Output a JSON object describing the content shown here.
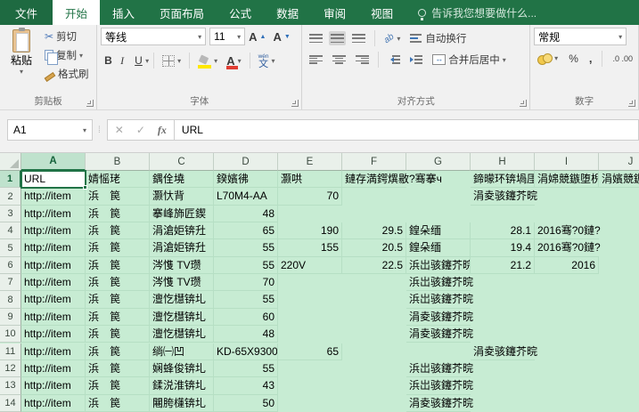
{
  "app": {
    "accent_color": "#217346",
    "fill_color": "#c7ecd3"
  },
  "tabbar": {
    "tabs": [
      "文件",
      "开始",
      "插入",
      "页面布局",
      "公式",
      "数据",
      "审阅",
      "视图"
    ],
    "active": "开始",
    "tell_me": "告诉我您想要做什么..."
  },
  "ribbon": {
    "clipboard": {
      "label": "剪贴板",
      "paste": "粘贴",
      "cut": "剪切",
      "copy": "复制",
      "format_painter": "格式刷"
    },
    "font": {
      "label": "字体",
      "family": "等线",
      "size": "11",
      "phonetic": "文",
      "phonetic_hint": "wén"
    },
    "alignment": {
      "label": "对齐方式",
      "wrap": "自动换行",
      "merge": "合并后居中"
    },
    "number": {
      "label": "数字",
      "format": "常规",
      "decimal_icons": ".0 .00",
      "percent": "%",
      "comma": ","
    }
  },
  "formula_bar": {
    "name_box": "A1",
    "cancel": "✕",
    "enter": "✓",
    "fx": "fx",
    "formula": "URL"
  },
  "sheet": {
    "columns": [
      "A",
      "B",
      "C",
      "D",
      "E",
      "F",
      "G",
      "H",
      "I",
      "J"
    ],
    "rows": 14,
    "selected": "A1",
    "cells": [
      {
        "ref": "A1",
        "v": "URL"
      },
      {
        "ref": "B1",
        "v": "婧愮珯"
      },
      {
        "ref": "C1",
        "v": "鍝佺墝"
      },
      {
        "ref": "D1",
        "v": "鍨嬪彿"
      },
      {
        "ref": "E1",
        "v": "灏哄"
      },
      {
        "ref": "F1",
        "v": "鏈存満鍔熼敭?骞搴ч",
        "of": true
      },
      {
        "ref": "H1",
        "v": "鍗曚环锛堝厓锛?"
      },
      {
        "ref": "I1",
        "v": "涓婂競鏃堕棿"
      },
      {
        "ref": "J1",
        "v": "涓嬪競鏃堕棿"
      },
      {
        "ref": "A2",
        "v": "http://item"
      },
      {
        "ref": "B2",
        "v": "浜　笢"
      },
      {
        "ref": "C2",
        "v": "灏忕背"
      },
      {
        "ref": "D2",
        "v": "L70M4-AA"
      },
      {
        "ref": "E2",
        "v": "70",
        "a": "r"
      },
      {
        "ref": "H2",
        "v": "涓夌骇鑳芥晥",
        "of": true
      },
      {
        "ref": "A3",
        "v": "http://item"
      },
      {
        "ref": "B3",
        "v": "浜　笢"
      },
      {
        "ref": "C3",
        "v": "搴峰斾匠鍥"
      },
      {
        "ref": "D3",
        "v": "48",
        "a": "r"
      },
      {
        "ref": "A4",
        "v": "http://item"
      },
      {
        "ref": "B4",
        "v": "浜　笢"
      },
      {
        "ref": "C4",
        "v": "涓滄姖锛圱"
      },
      {
        "ref": "D4",
        "v": "65",
        "a": "r"
      },
      {
        "ref": "E4",
        "v": "190",
        "a": "r"
      },
      {
        "ref": "F4",
        "v": "29.5",
        "a": "r"
      },
      {
        "ref": "G4",
        "v": "鍠朵缅"
      },
      {
        "ref": "H4",
        "v": "28.1",
        "a": "r"
      },
      {
        "ref": "I4",
        "v": "2016骞?0鏈?",
        "of": true
      },
      {
        "ref": "A5",
        "v": "http://item"
      },
      {
        "ref": "B5",
        "v": "浜　笢"
      },
      {
        "ref": "C5",
        "v": "涓滄姖锛圱"
      },
      {
        "ref": "D5",
        "v": "55",
        "a": "r"
      },
      {
        "ref": "E5",
        "v": "155",
        "a": "r"
      },
      {
        "ref": "F5",
        "v": "20.5",
        "a": "r"
      },
      {
        "ref": "G5",
        "v": "鍠朵缅"
      },
      {
        "ref": "H5",
        "v": "19.4",
        "a": "r"
      },
      {
        "ref": "I5",
        "v": "2016骞?0鏈?",
        "of": true
      },
      {
        "ref": "A6",
        "v": "http://item"
      },
      {
        "ref": "B6",
        "v": "浜　笢"
      },
      {
        "ref": "C6",
        "v": "涔愯 TV瓒"
      },
      {
        "ref": "D6",
        "v": "55",
        "a": "r"
      },
      {
        "ref": "E6",
        "v": "220V"
      },
      {
        "ref": "F6",
        "v": "22.5",
        "a": "r"
      },
      {
        "ref": "G6",
        "v": "浜岀骇鑳芥晥"
      },
      {
        "ref": "H6",
        "v": "21.2",
        "a": "r"
      },
      {
        "ref": "I6",
        "v": "2016",
        "a": "r"
      },
      {
        "ref": "A7",
        "v": "http://item"
      },
      {
        "ref": "B7",
        "v": "浜　笢"
      },
      {
        "ref": "C7",
        "v": "涔愯 TV瓒"
      },
      {
        "ref": "D7",
        "v": "70",
        "a": "r"
      },
      {
        "ref": "G7",
        "v": "浜岀骇鑳芥晥",
        "of": true
      },
      {
        "ref": "A8",
        "v": "http://item"
      },
      {
        "ref": "B8",
        "v": "浜　笢"
      },
      {
        "ref": "C8",
        "v": "澶忔櫘锛圠"
      },
      {
        "ref": "D8",
        "v": "55",
        "a": "r"
      },
      {
        "ref": "G8",
        "v": "浜岀骇鑳芥晥",
        "of": true
      },
      {
        "ref": "A9",
        "v": "http://item"
      },
      {
        "ref": "B9",
        "v": "浜　笢"
      },
      {
        "ref": "C9",
        "v": "澶忔櫘锛圠"
      },
      {
        "ref": "D9",
        "v": "60",
        "a": "r"
      },
      {
        "ref": "G9",
        "v": "涓夌骇鑳芥晥",
        "of": true
      },
      {
        "ref": "A10",
        "v": "http://item"
      },
      {
        "ref": "B10",
        "v": "浜　笢"
      },
      {
        "ref": "C10",
        "v": "澶忔櫘锛圠"
      },
      {
        "ref": "D10",
        "v": "48",
        "a": "r"
      },
      {
        "ref": "G10",
        "v": "涓夌骇鑳芥晥",
        "of": true
      },
      {
        "ref": "A11",
        "v": "http://item"
      },
      {
        "ref": "B11",
        "v": "浜　笢"
      },
      {
        "ref": "C11",
        "v": "绱㈠凹"
      },
      {
        "ref": "D11",
        "v": "KD-65X9300"
      },
      {
        "ref": "E11",
        "v": "65",
        "a": "r"
      },
      {
        "ref": "H11",
        "v": "涓夌骇鑳芥晥",
        "of": true
      },
      {
        "ref": "A12",
        "v": "http://item"
      },
      {
        "ref": "B12",
        "v": "浜　笢"
      },
      {
        "ref": "C12",
        "v": "娴蜂俊锛圠"
      },
      {
        "ref": "D12",
        "v": "55",
        "a": "r"
      },
      {
        "ref": "G12",
        "v": "浜岀骇鑳芥晥",
        "of": true
      },
      {
        "ref": "A13",
        "v": "http://item"
      },
      {
        "ref": "B13",
        "v": "浜　笢"
      },
      {
        "ref": "C13",
        "v": "鍒涚淮锛圠"
      },
      {
        "ref": "D13",
        "v": "43",
        "a": "r"
      },
      {
        "ref": "G13",
        "v": "浜岀骇鑳芥晥",
        "of": true
      },
      {
        "ref": "A14",
        "v": "http://item"
      },
      {
        "ref": "B14",
        "v": "浜　笢"
      },
      {
        "ref": "C14",
        "v": "闀胯櫣锛圠"
      },
      {
        "ref": "D14",
        "v": "50",
        "a": "r"
      },
      {
        "ref": "G14",
        "v": "涓夌骇鑳芥晥",
        "of": true
      }
    ]
  }
}
